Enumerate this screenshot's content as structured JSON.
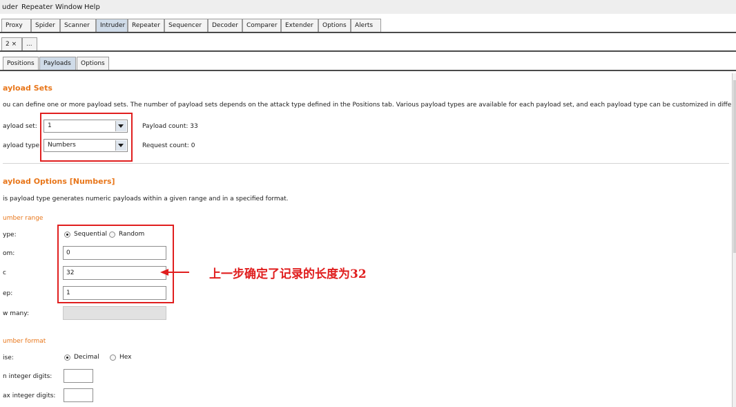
{
  "menubar": {
    "items": [
      "uder",
      "Repeater",
      "Window",
      "Help"
    ]
  },
  "main_tabs": [
    "Proxy",
    "Spider",
    "Scanner",
    "Intruder",
    "Repeater",
    "Sequencer",
    "Decoder",
    "Comparer",
    "Extender",
    "Options",
    "Alerts"
  ],
  "main_tabs_active": "Intruder",
  "attack_tabs": [
    "2 ×",
    "..."
  ],
  "sub_tabs": [
    "Positions",
    "Payloads",
    "Options"
  ],
  "sub_tabs_active": "Payloads",
  "payload_sets": {
    "title": "ayload Sets",
    "description": "ou can define one or more payload sets. The number of payload sets depends on the attack type defined in the Positions tab. Various payload types are available for each payload set, and each payload type can be customized in different ways.",
    "set_label": "ayload set:",
    "set_value": "1",
    "type_label": "ayload type:",
    "type_value": "Numbers",
    "payload_count": "Payload count: 33",
    "request_count": "Request count: 0"
  },
  "payload_options": {
    "title": "ayload Options [Numbers]",
    "description": "is payload type generates numeric payloads within a given range and in a specified format.",
    "number_range_title": "umber range",
    "type_label": "ype:",
    "sequential_label": "Sequential",
    "random_label": "Random",
    "selected_range_type": "Sequential",
    "from_label": "om:",
    "from_value": "0",
    "to_label": "c",
    "to_value": "32",
    "step_label": "ep:",
    "step_value": "1",
    "how_many_label": "w many:",
    "how_many_value": "",
    "number_format_title": "umber format",
    "base_label": "ise:",
    "decimal_label": "Decimal",
    "hex_label": "Hex",
    "selected_base": "Decimal",
    "min_int_label": "n integer digits:",
    "min_int_value": "",
    "max_int_label": "ax integer digits:",
    "max_int_value": ""
  },
  "annotation": {
    "text": "上一步确定了记录的长度为32",
    "color": "#e01e1e"
  },
  "colors": {
    "accent_orange": "#e8761a",
    "annotation_red": "#e01e1e",
    "active_tab": "#cfdbe8"
  }
}
